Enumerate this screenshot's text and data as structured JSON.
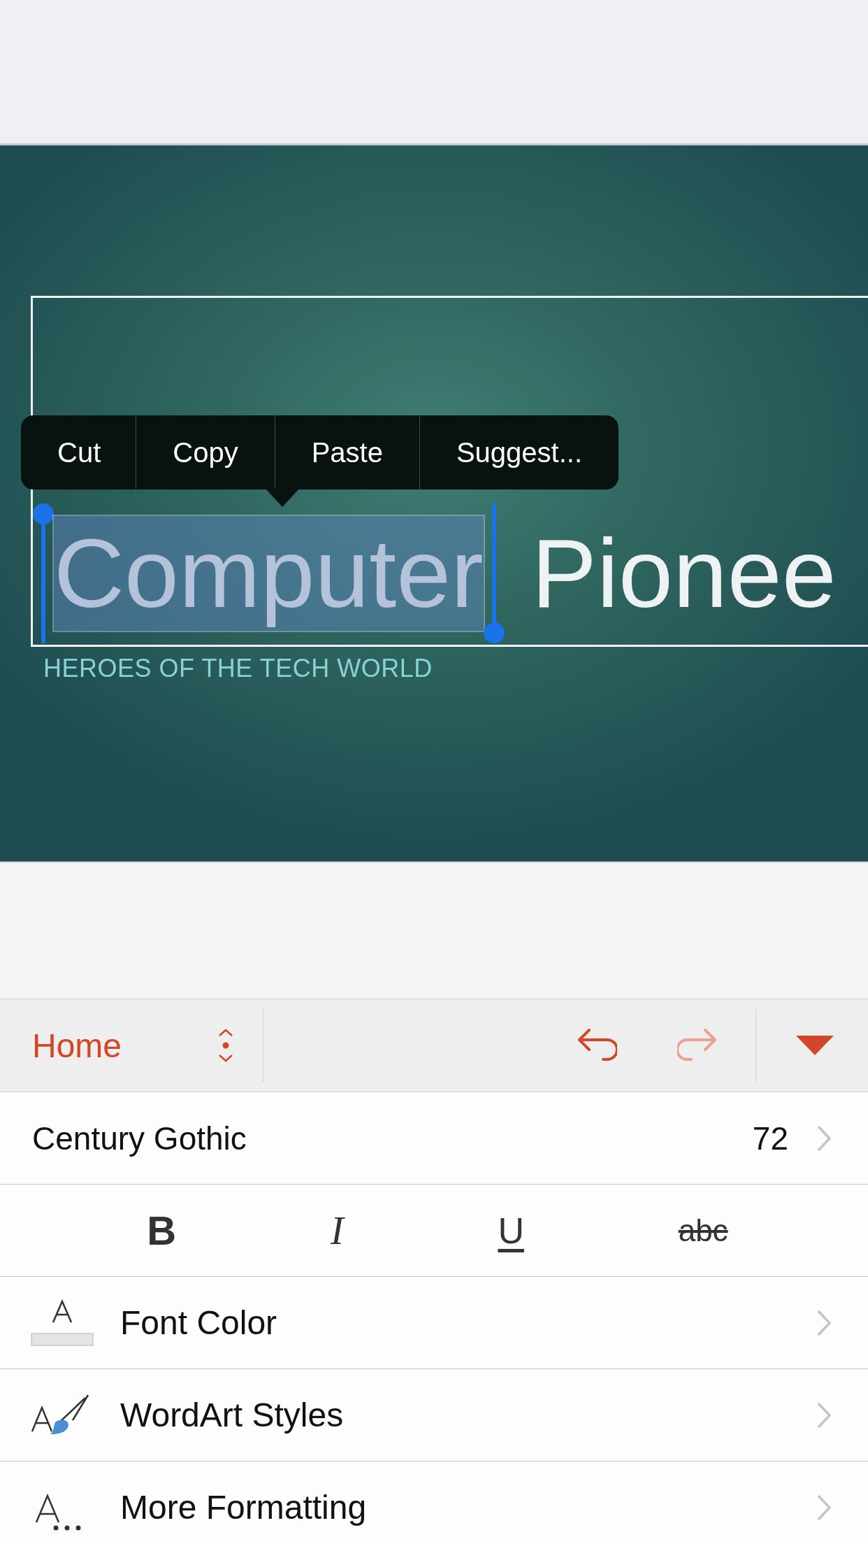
{
  "slide": {
    "title_parts": [
      {
        "text": "Computer",
        "selected": true
      },
      {
        "text": " Pionee",
        "selected": false
      }
    ],
    "subtitle": "HEROES OF THE TECH WORLD"
  },
  "edit_menu": [
    "Cut",
    "Copy",
    "Paste",
    "Suggest..."
  ],
  "toolbar": {
    "tab": "Home",
    "buttons": [
      {
        "kind": "undo",
        "disabled": false
      },
      {
        "kind": "redo",
        "disabled": true
      }
    ]
  },
  "font": {
    "name": "Century Gothic",
    "size": "72"
  },
  "format_buttons": [
    {
      "kind": "bold",
      "label": "B",
      "selected": false
    },
    {
      "kind": "italic",
      "label": "I",
      "selected": false
    },
    {
      "kind": "underline",
      "label": "U",
      "selected": false
    },
    {
      "kind": "strikethrough",
      "label": "abc",
      "selected": false
    }
  ],
  "rows": [
    {
      "kind": "font-color",
      "label": "Font Color"
    },
    {
      "kind": "wordart",
      "label": "WordArt Styles"
    },
    {
      "kind": "more",
      "label": "More Formatting"
    }
  ]
}
